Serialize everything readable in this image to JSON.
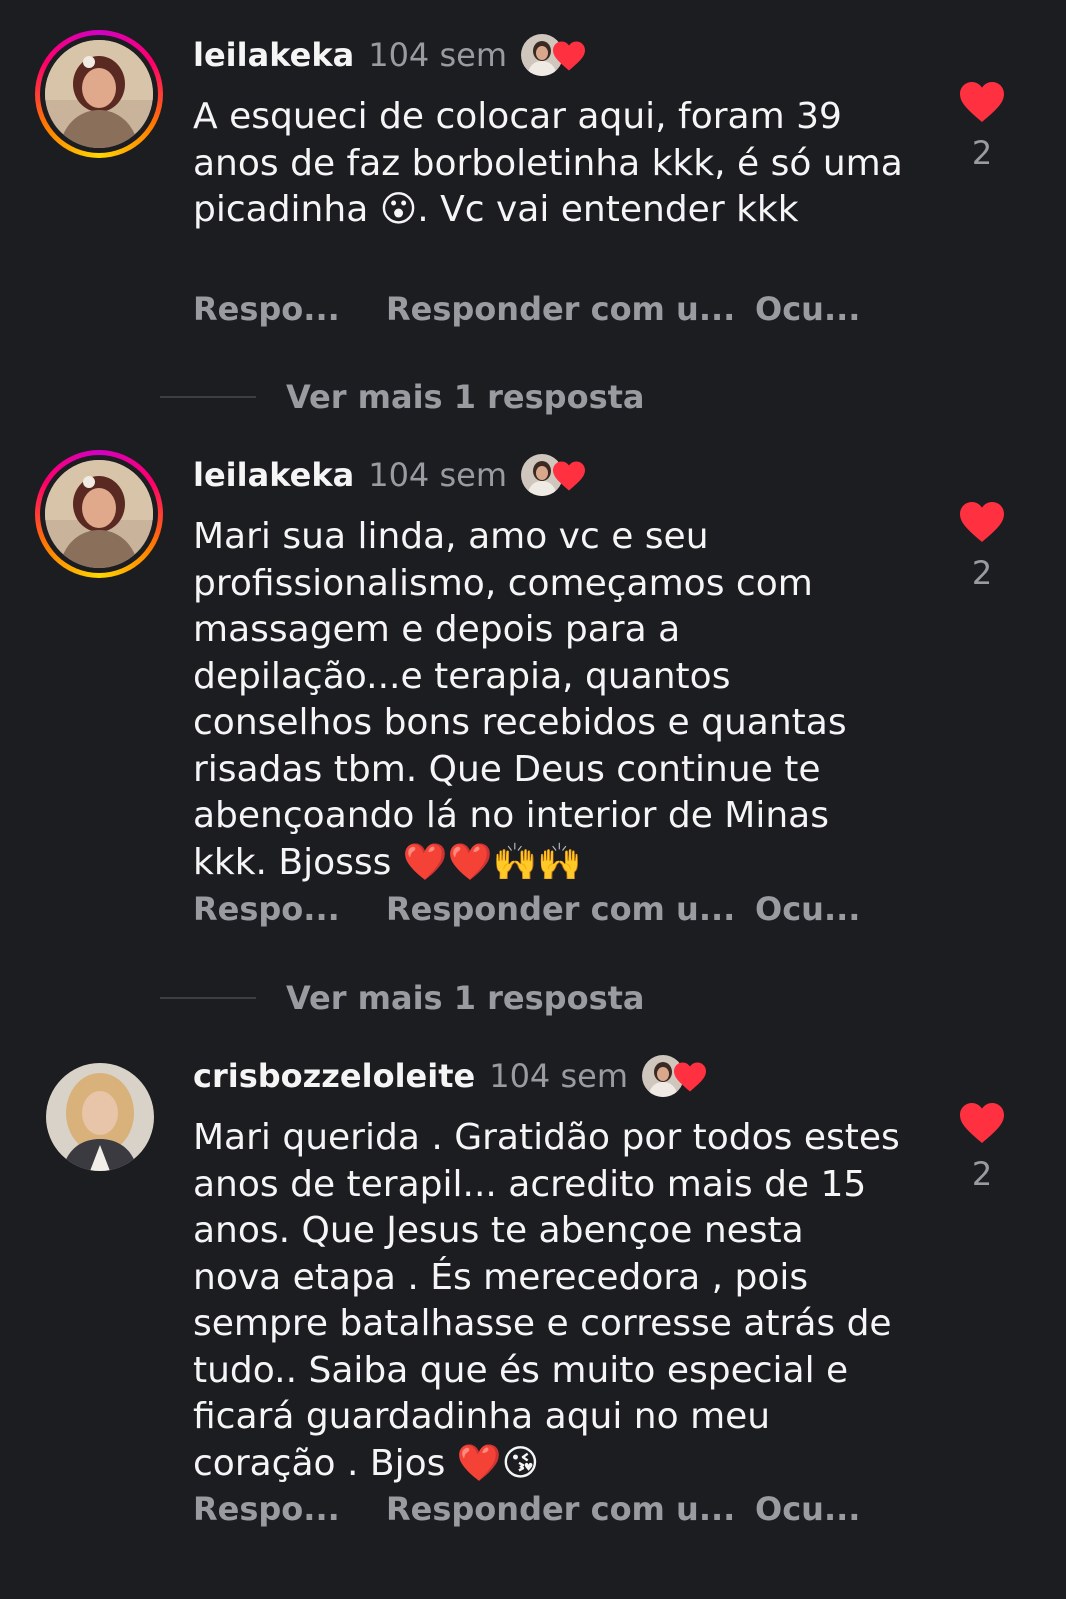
{
  "colors": {
    "background": "#1c1d21",
    "text": "#f5f5f5",
    "muted": "#9a9ba0",
    "heart": "#ff3040"
  },
  "comments": [
    {
      "username": "leilakeka",
      "time": "104 sem",
      "liked_by_author": true,
      "text": "A esqueci de colocar aqui, foram 39 anos de faz borboletinha kkk, é  só uma picadinha 😮. Vc vai entender kkk",
      "likes": "2",
      "actions": {
        "reply": "Respo...",
        "reply_sticker": "Responder com u...",
        "hide": "Ocu..."
      },
      "view_more": "Ver mais 1 resposta",
      "avatar_ring": true
    },
    {
      "username": "leilakeka",
      "time": "104 sem",
      "liked_by_author": true,
      "text": "Mari sua linda, amo vc e seu profissionalismo, começamos com massagem e depois para a depilação...e terapia, quantos conselhos bons recebidos e quantas risadas tbm. Que Deus continue te abençoando lá no interior de Minas kkk. Bjosss ❤️❤️🙌🙌",
      "likes": "2",
      "actions": {
        "reply": "Respo...",
        "reply_sticker": "Responder com u...",
        "hide": "Ocu..."
      },
      "view_more": "Ver mais 1 resposta",
      "avatar_ring": true
    },
    {
      "username": "crisbozzeloleite",
      "time": "104 sem",
      "liked_by_author": true,
      "text": "Mari querida . Gratidão por todos estes anos de terapil... acredito mais de 15 anos. Que Jesus te abençoe nesta nova etapa . És merecedora , pois sempre batalhasse e corresse atrás de tudo.. Saiba que és muito especial e ficará guardadinha aqui no meu coração . Bjos ❤️😘",
      "likes": "2",
      "actions": {
        "reply": "Respo...",
        "reply_sticker": "Responder com u...",
        "hide": "Ocu..."
      },
      "avatar_ring": false
    }
  ]
}
